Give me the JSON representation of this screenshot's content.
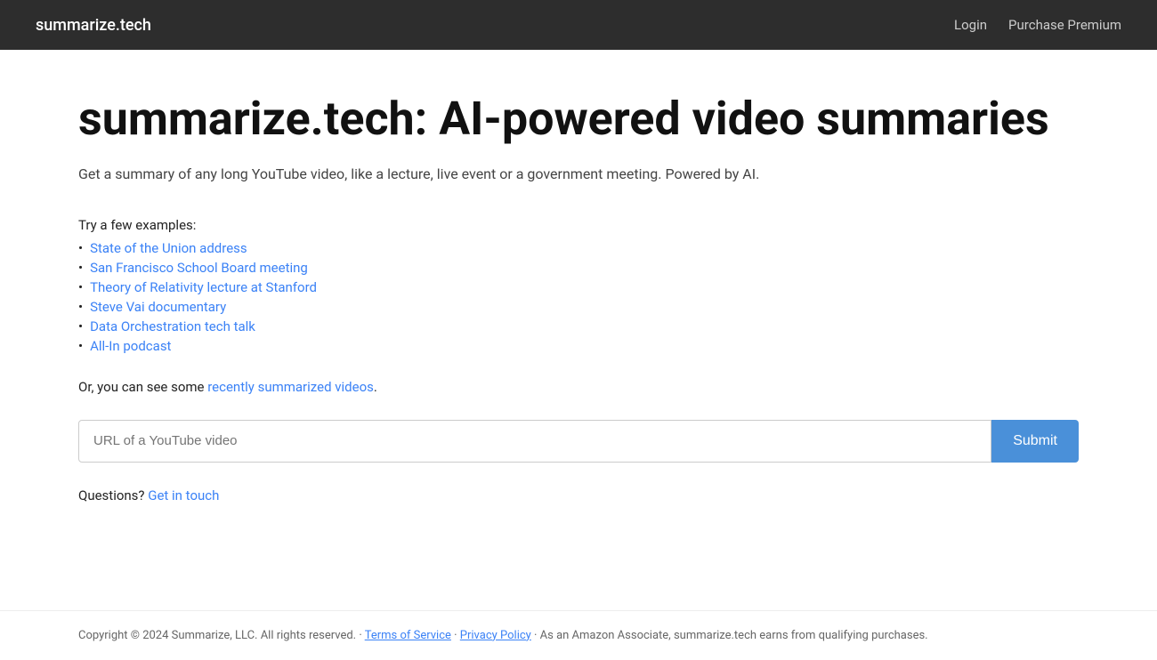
{
  "header": {
    "logo": "summarize.tech",
    "nav": {
      "login_label": "Login",
      "purchase_label": "Purchase Premium"
    }
  },
  "main": {
    "heading": "summarize.tech: AI-powered video summaries",
    "subtitle": "Get a summary of any long YouTube video, like a lecture, live event or a government meeting. Powered by AI.",
    "examples_intro": "Try a few examples:",
    "examples": [
      {
        "label": "State of the Union address",
        "url": "#"
      },
      {
        "label": "San Francisco School Board meeting",
        "url": "#"
      },
      {
        "label": "Theory of Relativity lecture at Stanford",
        "url": "#"
      },
      {
        "label": "Steve Vai documentary",
        "url": "#"
      },
      {
        "label": "Data Orchestration tech talk",
        "url": "#"
      },
      {
        "label": "All-In podcast",
        "url": "#"
      }
    ],
    "recently_text_before": "Or, you can see some ",
    "recently_link_label": "recently summarized videos",
    "recently_text_after": ".",
    "url_placeholder": "URL of a YouTube video",
    "submit_label": "Submit",
    "questions_text": "Questions? ",
    "get_in_touch_label": "Get in touch"
  },
  "footer": {
    "copyright": "Copyright © 2024 Summarize, LLC. All rights reserved. · ",
    "terms_label": "Terms of Service",
    "separator1": " · ",
    "privacy_label": "Privacy Policy",
    "separator2": " · As an Amazon Associate, summarize.tech earns from qualifying purchases."
  }
}
